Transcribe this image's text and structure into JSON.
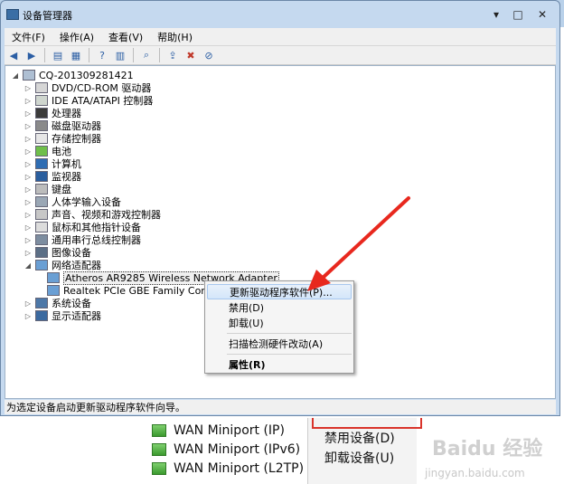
{
  "window": {
    "title": "设备管理器",
    "controls": {
      "minimize": "▾",
      "maximize": "□",
      "close": "✕"
    }
  },
  "menubar": {
    "items": [
      {
        "label": "文件(F)"
      },
      {
        "label": "操作(A)"
      },
      {
        "label": "查看(V)"
      },
      {
        "label": "帮助(H)"
      }
    ]
  },
  "toolbar": {
    "icons": [
      "back-icon",
      "forward-icon",
      "properties-icon",
      "view-icon",
      "help-icon",
      "scan-icon",
      "update-driver-icon",
      "uninstall-icon",
      "disable-icon"
    ]
  },
  "tree": {
    "root": "CQ-201309281421",
    "nodes": [
      {
        "label": "DVD/CD-ROM 驱动器",
        "expanded": false
      },
      {
        "label": "IDE ATA/ATAPI 控制器",
        "expanded": false
      },
      {
        "label": "处理器",
        "expanded": false
      },
      {
        "label": "磁盘驱动器",
        "expanded": false
      },
      {
        "label": "存储控制器",
        "expanded": false
      },
      {
        "label": "电池",
        "expanded": false
      },
      {
        "label": "计算机",
        "expanded": false
      },
      {
        "label": "监视器",
        "expanded": false
      },
      {
        "label": "键盘",
        "expanded": false
      },
      {
        "label": "人体学输入设备",
        "expanded": false
      },
      {
        "label": "声音、视频和游戏控制器",
        "expanded": false
      },
      {
        "label": "鼠标和其他指针设备",
        "expanded": false
      },
      {
        "label": "通用串行总线控制器",
        "expanded": false
      },
      {
        "label": "图像设备",
        "expanded": false
      },
      {
        "label": "网络适配器",
        "expanded": true
      },
      {
        "label": "Atheros AR9285 Wireless Network Adapter",
        "child": true,
        "selected": true
      },
      {
        "label": "Realtek PCIe GBE Family Controller",
        "child": true
      },
      {
        "label": "系统设备",
        "expanded": false
      },
      {
        "label": "显示适配器",
        "expanded": false
      }
    ]
  },
  "status_text": "为选定设备启动更新驱动程序软件向导。",
  "context_menu": {
    "items": [
      {
        "label": "更新驱动程序软件(P)...",
        "hover": true
      },
      {
        "label": "禁用(D)"
      },
      {
        "label": "卸载(U)"
      },
      {
        "label": "扫描检测硬件改动(A)"
      },
      {
        "label": "属性(R)",
        "bold": true
      }
    ]
  },
  "background": {
    "list_items": [
      "WAN Miniport (IP)",
      "WAN Miniport (IPv6)",
      "WAN Miniport (L2TP)"
    ],
    "menu_items": [
      "禁用设备(D)",
      "卸载设备(U)"
    ],
    "watermark": "Baidu 经验",
    "watermark_sub": "jingyan.baidu.com"
  },
  "colors": {
    "arrow": "#e8281e",
    "highlight_border": "#d9342b"
  }
}
